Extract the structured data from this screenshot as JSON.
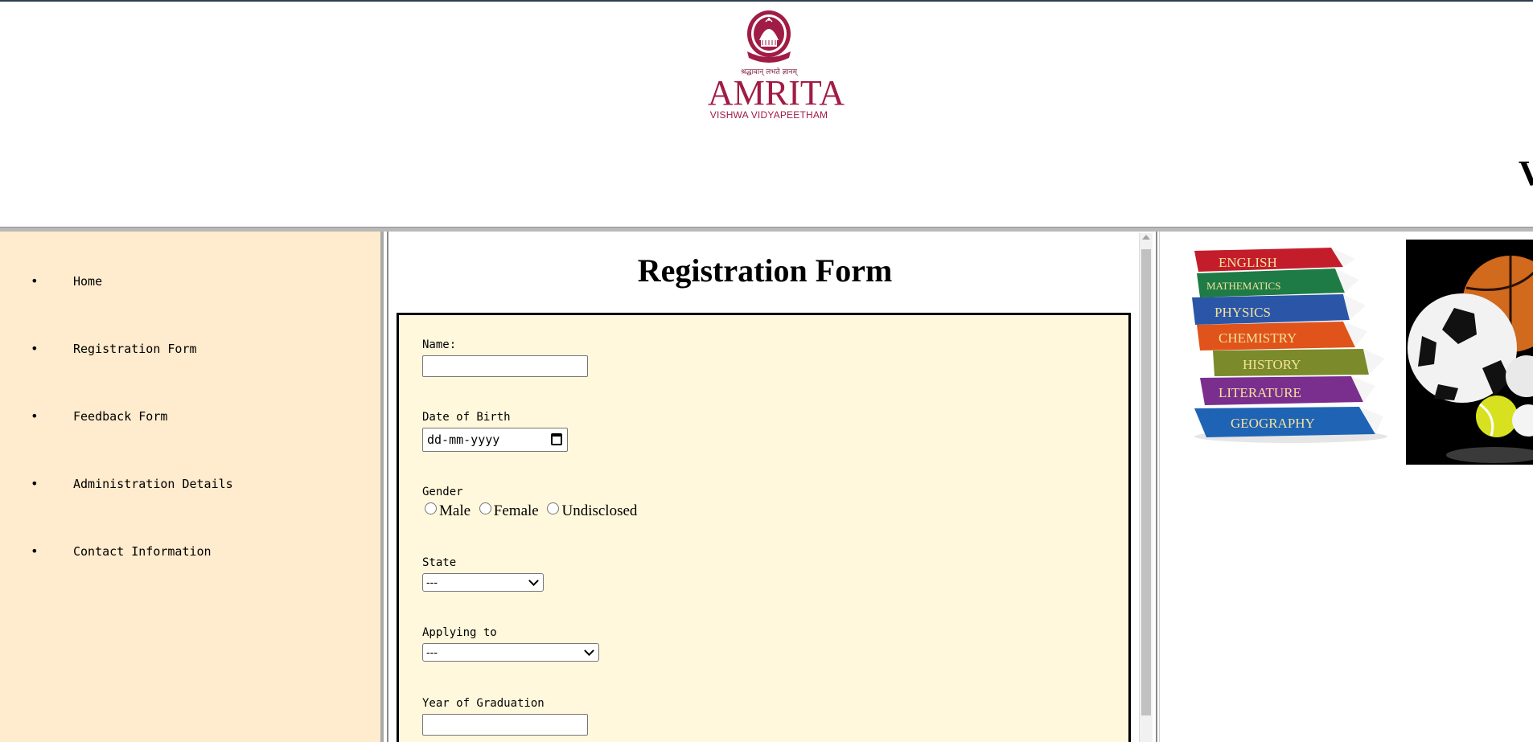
{
  "header": {
    "logo": {
      "motto": "श्रद्धावान् लभते ज्ञानम्",
      "name": "AMRITA",
      "subtitle": "VISHWA VIDYAPEETHAM",
      "color": "#a11c45"
    },
    "clipped_heading": "V"
  },
  "sidebar": {
    "background": "#ffebcd",
    "items": [
      {
        "bullet": "•",
        "label": "Home"
      },
      {
        "bullet": "•",
        "label": "Registration Form"
      },
      {
        "bullet": "•",
        "label": "Feedback Form"
      },
      {
        "bullet": "•",
        "label": "Administration Details"
      },
      {
        "bullet": "•",
        "label": "Contact Information"
      }
    ]
  },
  "main": {
    "title": "Registration Form",
    "form": {
      "background": "#fff8dc",
      "name_label": "Name:",
      "name_value": "",
      "dob_label": "Date of Birth",
      "dob_placeholder": "dd-mm-yyyy",
      "gender_label": "Gender",
      "gender_options": [
        "Male",
        "Female",
        "Undisclosed"
      ],
      "state_label": "State",
      "state_selected": "---",
      "applying_label": "Applying to",
      "applying_selected": "---",
      "graduation_label": "Year of Graduation",
      "graduation_value": ""
    }
  },
  "right_panel": {
    "books_image": {
      "icon": "stacked-books-image",
      "spines": [
        "ENGLISH",
        "MATHEMATICS",
        "PHYSICS",
        "CHEMISTRY",
        "HISTORY",
        "LITERATURE",
        "GEOGRAPHY"
      ]
    },
    "sports_image": {
      "icon": "sports-balls-image"
    }
  }
}
